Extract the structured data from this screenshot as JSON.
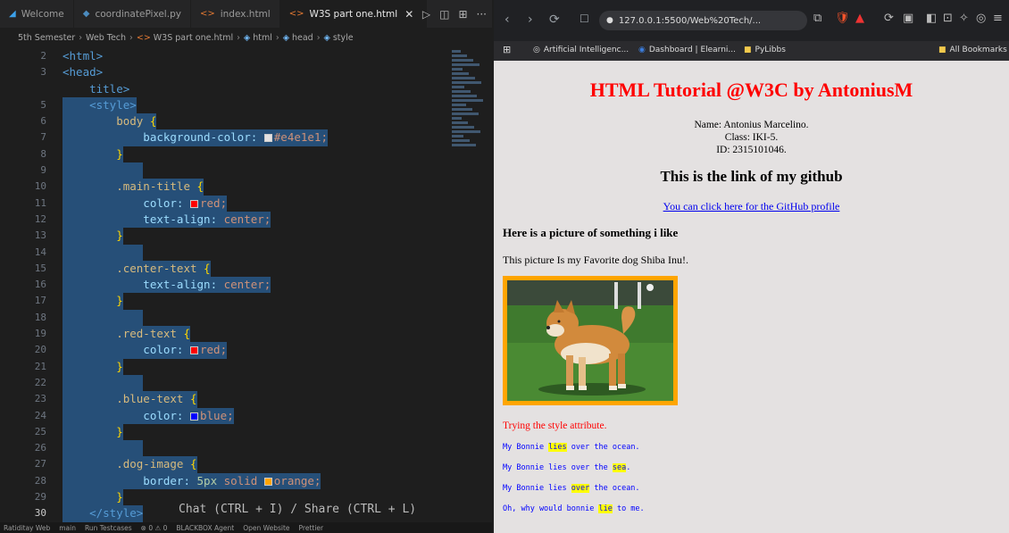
{
  "editor": {
    "tabs": [
      {
        "label": "Welcome",
        "icon": "vscode-logo-icon",
        "active": false
      },
      {
        "label": "coordinatePixel.py",
        "icon": "python-file-icon",
        "active": false
      },
      {
        "label": "index.html",
        "icon": "html-file-icon",
        "active": false
      },
      {
        "label": "W3S part one.html",
        "icon": "html-file-icon",
        "active": true
      }
    ],
    "close_glyph": "✕",
    "actions": [
      "▷",
      "◫",
      "⊞",
      "···"
    ],
    "breadcrumb": [
      "5th Semester",
      "Web Tech",
      "W3S part one.html",
      "html",
      "head",
      "style"
    ],
    "lines": [
      {
        "n": "2",
        "tokens": [
          {
            "t": "<html>",
            "c": "t"
          }
        ]
      },
      {
        "n": "3",
        "tokens": [
          {
            "t": "<head>",
            "c": "t"
          }
        ]
      },
      {
        "n": "",
        "tokens": [
          {
            "t": "    title>",
            "c": "t"
          }
        ]
      },
      {
        "n": "5",
        "tokens": [
          {
            "t": "    <style>",
            "c": "t"
          }
        ]
      },
      {
        "n": "6",
        "tokens": [
          {
            "t": "        body ",
            "c": "s"
          },
          {
            "t": "{",
            "c": "b"
          }
        ]
      },
      {
        "n": "7",
        "tokens": [
          {
            "t": "            background-color: ",
            "c": "p"
          },
          {
            "t": "",
            "c": "sw",
            "swatch": "#e4e1e1"
          },
          {
            "t": "#e4e1e1;",
            "c": "v"
          }
        ]
      },
      {
        "n": "8",
        "tokens": [
          {
            "t": "        }",
            "c": "b"
          }
        ]
      },
      {
        "n": "9",
        "tokens": []
      },
      {
        "n": "10",
        "tokens": [
          {
            "t": "        .main-title ",
            "c": "s"
          },
          {
            "t": "{",
            "c": "b"
          }
        ]
      },
      {
        "n": "11",
        "tokens": [
          {
            "t": "            color: ",
            "c": "p"
          },
          {
            "t": "",
            "c": "sw",
            "swatch": "#ff0000"
          },
          {
            "t": "red;",
            "c": "v"
          }
        ]
      },
      {
        "n": "12",
        "tokens": [
          {
            "t": "            text-align: ",
            "c": "p"
          },
          {
            "t": "center;",
            "c": "v"
          }
        ]
      },
      {
        "n": "13",
        "tokens": [
          {
            "t": "        }",
            "c": "b"
          }
        ]
      },
      {
        "n": "14",
        "tokens": []
      },
      {
        "n": "15",
        "tokens": [
          {
            "t": "        .center-text ",
            "c": "s"
          },
          {
            "t": "{",
            "c": "b"
          }
        ]
      },
      {
        "n": "16",
        "tokens": [
          {
            "t": "            text-align: ",
            "c": "p"
          },
          {
            "t": "center;",
            "c": "v"
          }
        ]
      },
      {
        "n": "17",
        "tokens": [
          {
            "t": "        }",
            "c": "b"
          }
        ]
      },
      {
        "n": "18",
        "tokens": []
      },
      {
        "n": "19",
        "tokens": [
          {
            "t": "        .red-text ",
            "c": "s"
          },
          {
            "t": "{",
            "c": "b"
          }
        ]
      },
      {
        "n": "20",
        "tokens": [
          {
            "t": "            color: ",
            "c": "p"
          },
          {
            "t": "",
            "c": "sw",
            "swatch": "#ff0000"
          },
          {
            "t": "red;",
            "c": "v"
          }
        ]
      },
      {
        "n": "21",
        "tokens": [
          {
            "t": "        }",
            "c": "b"
          }
        ]
      },
      {
        "n": "22",
        "tokens": []
      },
      {
        "n": "23",
        "tokens": [
          {
            "t": "        .blue-text ",
            "c": "s"
          },
          {
            "t": "{",
            "c": "b"
          }
        ]
      },
      {
        "n": "24",
        "tokens": [
          {
            "t": "            color: ",
            "c": "p"
          },
          {
            "t": "",
            "c": "sw",
            "swatch": "#0000ff"
          },
          {
            "t": "blue;",
            "c": "v"
          }
        ]
      },
      {
        "n": "25",
        "tokens": [
          {
            "t": "        }",
            "c": "b"
          }
        ]
      },
      {
        "n": "26",
        "tokens": []
      },
      {
        "n": "27",
        "tokens": [
          {
            "t": "        .dog-image ",
            "c": "s"
          },
          {
            "t": "{",
            "c": "b"
          }
        ]
      },
      {
        "n": "28",
        "tokens": [
          {
            "t": "            border: ",
            "c": "p"
          },
          {
            "t": "5px ",
            "c": "n"
          },
          {
            "t": "solid ",
            "c": "v"
          },
          {
            "t": "",
            "c": "sw",
            "swatch": "#ffa500"
          },
          {
            "t": "orange;",
            "c": "v"
          }
        ]
      },
      {
        "n": "29",
        "tokens": [
          {
            "t": "        }",
            "c": "b"
          }
        ]
      },
      {
        "n": "30",
        "tokens": [
          {
            "t": "    </style>",
            "c": "t"
          }
        ],
        "current": true
      }
    ],
    "inline_hint": "Chat (CTRL + I) / Share (CTRL + L)",
    "status": [
      "Ratiditay Web",
      "main",
      "Run Testcases",
      "⊗ 0 ⚠ 0",
      "BLACKBOX Agent",
      "Open Website",
      "Prettier"
    ]
  },
  "browser": {
    "nav": [
      "‹",
      "›",
      "⟳"
    ],
    "url": "127.0.0.1:5500/Web%20Tech/...",
    "extensions": [
      "⧉",
      "🛡",
      "▲",
      "⟳",
      "▣",
      "◧",
      "⊡",
      "✧",
      "◎",
      "≡"
    ],
    "bookmarks": [
      {
        "label": "Artificial Intelligenc...",
        "icon": "openai-icon"
      },
      {
        "label": "Dashboard | Elearni...",
        "icon": "site-icon"
      },
      {
        "label": "PyLibbs",
        "icon": "folder-icon"
      }
    ],
    "all_bookmarks": "All Bookmarks",
    "apps_glyph": "⊞"
  },
  "page": {
    "title": "HTML Tutorial @W3C by AntoniusM",
    "info": [
      "Name: Antonius Marcelino.",
      "Class: IKI-5.",
      "ID: 2315101046."
    ],
    "github_heading": "This is the link of my github",
    "github_link": "You can click here for the GitHub profile",
    "picture_heading": "Here is a picture of something i like",
    "picture_desc": "This picture Is my Favorite dog Shiba Inu!.",
    "style_attr": "Trying the style attribute.",
    "poem": [
      {
        "before": "My Bonnie ",
        "hl": "lies",
        "after": " over the ocean."
      },
      {
        "before": "My Bonnie lies over the ",
        "hl": "sea",
        "after": "."
      },
      {
        "before": "My Bonnie lies ",
        "hl": "over",
        "after": " the ocean."
      },
      {
        "before": "Oh, why would bonnie ",
        "hl": "lie",
        "after": " to me."
      }
    ]
  },
  "colors": {
    "page_bg": "#e4e1e1",
    "title": "#ff0000",
    "link": "#0000ee",
    "highlight": "#ffff00",
    "border": "#ffa500"
  }
}
